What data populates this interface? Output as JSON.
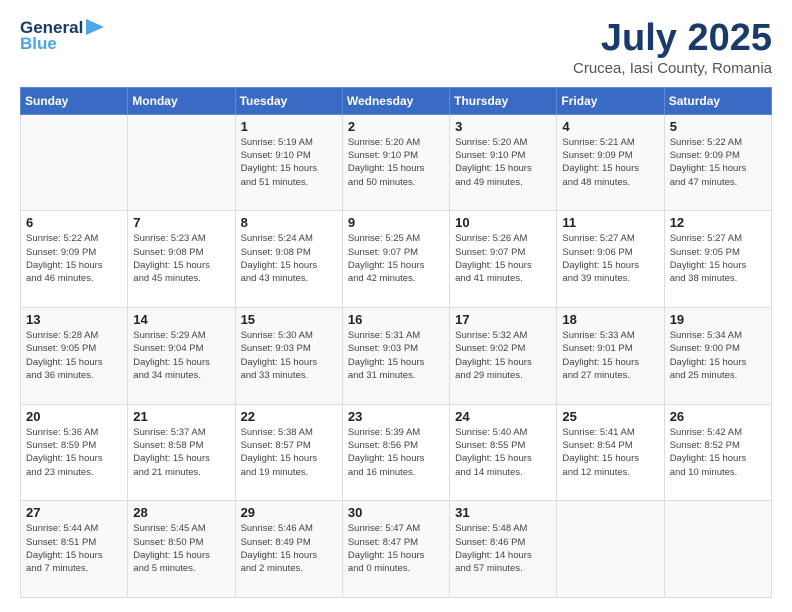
{
  "header": {
    "logo_general": "General",
    "logo_blue": "Blue",
    "month_title": "July 2025",
    "location": "Crucea, Iasi County, Romania"
  },
  "days_of_week": [
    "Sunday",
    "Monday",
    "Tuesday",
    "Wednesday",
    "Thursday",
    "Friday",
    "Saturday"
  ],
  "weeks": [
    [
      {
        "day": "",
        "info": ""
      },
      {
        "day": "",
        "info": ""
      },
      {
        "day": "1",
        "info": "Sunrise: 5:19 AM\nSunset: 9:10 PM\nDaylight: 15 hours\nand 51 minutes."
      },
      {
        "day": "2",
        "info": "Sunrise: 5:20 AM\nSunset: 9:10 PM\nDaylight: 15 hours\nand 50 minutes."
      },
      {
        "day": "3",
        "info": "Sunrise: 5:20 AM\nSunset: 9:10 PM\nDaylight: 15 hours\nand 49 minutes."
      },
      {
        "day": "4",
        "info": "Sunrise: 5:21 AM\nSunset: 9:09 PM\nDaylight: 15 hours\nand 48 minutes."
      },
      {
        "day": "5",
        "info": "Sunrise: 5:22 AM\nSunset: 9:09 PM\nDaylight: 15 hours\nand 47 minutes."
      }
    ],
    [
      {
        "day": "6",
        "info": "Sunrise: 5:22 AM\nSunset: 9:09 PM\nDaylight: 15 hours\nand 46 minutes."
      },
      {
        "day": "7",
        "info": "Sunrise: 5:23 AM\nSunset: 9:08 PM\nDaylight: 15 hours\nand 45 minutes."
      },
      {
        "day": "8",
        "info": "Sunrise: 5:24 AM\nSunset: 9:08 PM\nDaylight: 15 hours\nand 43 minutes."
      },
      {
        "day": "9",
        "info": "Sunrise: 5:25 AM\nSunset: 9:07 PM\nDaylight: 15 hours\nand 42 minutes."
      },
      {
        "day": "10",
        "info": "Sunrise: 5:26 AM\nSunset: 9:07 PM\nDaylight: 15 hours\nand 41 minutes."
      },
      {
        "day": "11",
        "info": "Sunrise: 5:27 AM\nSunset: 9:06 PM\nDaylight: 15 hours\nand 39 minutes."
      },
      {
        "day": "12",
        "info": "Sunrise: 5:27 AM\nSunset: 9:05 PM\nDaylight: 15 hours\nand 38 minutes."
      }
    ],
    [
      {
        "day": "13",
        "info": "Sunrise: 5:28 AM\nSunset: 9:05 PM\nDaylight: 15 hours\nand 36 minutes."
      },
      {
        "day": "14",
        "info": "Sunrise: 5:29 AM\nSunset: 9:04 PM\nDaylight: 15 hours\nand 34 minutes."
      },
      {
        "day": "15",
        "info": "Sunrise: 5:30 AM\nSunset: 9:03 PM\nDaylight: 15 hours\nand 33 minutes."
      },
      {
        "day": "16",
        "info": "Sunrise: 5:31 AM\nSunset: 9:03 PM\nDaylight: 15 hours\nand 31 minutes."
      },
      {
        "day": "17",
        "info": "Sunrise: 5:32 AM\nSunset: 9:02 PM\nDaylight: 15 hours\nand 29 minutes."
      },
      {
        "day": "18",
        "info": "Sunrise: 5:33 AM\nSunset: 9:01 PM\nDaylight: 15 hours\nand 27 minutes."
      },
      {
        "day": "19",
        "info": "Sunrise: 5:34 AM\nSunset: 9:00 PM\nDaylight: 15 hours\nand 25 minutes."
      }
    ],
    [
      {
        "day": "20",
        "info": "Sunrise: 5:36 AM\nSunset: 8:59 PM\nDaylight: 15 hours\nand 23 minutes."
      },
      {
        "day": "21",
        "info": "Sunrise: 5:37 AM\nSunset: 8:58 PM\nDaylight: 15 hours\nand 21 minutes."
      },
      {
        "day": "22",
        "info": "Sunrise: 5:38 AM\nSunset: 8:57 PM\nDaylight: 15 hours\nand 19 minutes."
      },
      {
        "day": "23",
        "info": "Sunrise: 5:39 AM\nSunset: 8:56 PM\nDaylight: 15 hours\nand 16 minutes."
      },
      {
        "day": "24",
        "info": "Sunrise: 5:40 AM\nSunset: 8:55 PM\nDaylight: 15 hours\nand 14 minutes."
      },
      {
        "day": "25",
        "info": "Sunrise: 5:41 AM\nSunset: 8:54 PM\nDaylight: 15 hours\nand 12 minutes."
      },
      {
        "day": "26",
        "info": "Sunrise: 5:42 AM\nSunset: 8:52 PM\nDaylight: 15 hours\nand 10 minutes."
      }
    ],
    [
      {
        "day": "27",
        "info": "Sunrise: 5:44 AM\nSunset: 8:51 PM\nDaylight: 15 hours\nand 7 minutes."
      },
      {
        "day": "28",
        "info": "Sunrise: 5:45 AM\nSunset: 8:50 PM\nDaylight: 15 hours\nand 5 minutes."
      },
      {
        "day": "29",
        "info": "Sunrise: 5:46 AM\nSunset: 8:49 PM\nDaylight: 15 hours\nand 2 minutes."
      },
      {
        "day": "30",
        "info": "Sunrise: 5:47 AM\nSunset: 8:47 PM\nDaylight: 15 hours\nand 0 minutes."
      },
      {
        "day": "31",
        "info": "Sunrise: 5:48 AM\nSunset: 8:46 PM\nDaylight: 14 hours\nand 57 minutes."
      },
      {
        "day": "",
        "info": ""
      },
      {
        "day": "",
        "info": ""
      }
    ]
  ]
}
